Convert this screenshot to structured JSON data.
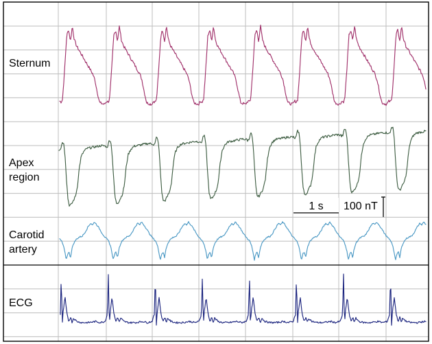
{
  "chart_data": {
    "type": "line",
    "title": "",
    "xlabel": "",
    "ylabel": "",
    "grid": true,
    "legend": "none",
    "beats_visible": 8,
    "series": [
      {
        "name": "Sternum",
        "label_lines": [
          "Sternum"
        ],
        "color": "#a0306a",
        "waveform": "sternum",
        "amplitude": 118,
        "beat_shape": [
          [
            0,
            0.04
          ],
          [
            0.03,
            0.03
          ],
          [
            0.06,
            0.06
          ],
          [
            0.1,
            0.38
          ],
          [
            0.15,
            0.85
          ],
          [
            0.19,
            0.92
          ],
          [
            0.23,
            0.78
          ],
          [
            0.27,
            0.97
          ],
          [
            0.31,
            0.8
          ],
          [
            0.36,
            0.72
          ],
          [
            0.46,
            0.62
          ],
          [
            0.56,
            0.52
          ],
          [
            0.64,
            0.44
          ],
          [
            0.7,
            0.38
          ],
          [
            0.75,
            0.3
          ],
          [
            0.8,
            0.15
          ],
          [
            0.85,
            0.02
          ],
          [
            0.9,
            0.01
          ],
          [
            0.95,
            0.0
          ],
          [
            1,
            0.04
          ]
        ]
      },
      {
        "name": "Apex region",
        "label_lines": [
          "Apex",
          "region"
        ],
        "color": "#3f5e43",
        "waveform": "apex",
        "amplitude": 100,
        "beat_shape": [
          [
            0,
            0.84
          ],
          [
            0.04,
            0.86
          ],
          [
            0.07,
            0.95
          ],
          [
            0.1,
            0.93
          ],
          [
            0.13,
            0.75
          ],
          [
            0.16,
            0.4
          ],
          [
            0.19,
            0.12
          ],
          [
            0.22,
            0.02
          ],
          [
            0.26,
            0.03
          ],
          [
            0.3,
            0.08
          ],
          [
            0.35,
            0.15
          ],
          [
            0.39,
            0.28
          ],
          [
            0.43,
            0.55
          ],
          [
            0.47,
            0.72
          ],
          [
            0.53,
            0.8
          ],
          [
            0.6,
            0.84
          ],
          [
            0.7,
            0.85
          ],
          [
            0.8,
            0.86
          ],
          [
            0.9,
            0.87
          ],
          [
            1,
            0.86
          ]
        ]
      },
      {
        "name": "Carotid artery",
        "label_lines": [
          "Carotid",
          "artery"
        ],
        "color": "#4a98c4",
        "waveform": "carotid",
        "amplitude": 58,
        "beat_shape": [
          [
            0,
            0.55
          ],
          [
            0.04,
            0.5
          ],
          [
            0.08,
            0.38
          ],
          [
            0.11,
            0.22
          ],
          [
            0.14,
            0.03
          ],
          [
            0.17,
            0.18
          ],
          [
            0.2,
            0.22
          ],
          [
            0.23,
            0.08
          ],
          [
            0.26,
            0.3
          ],
          [
            0.3,
            0.45
          ],
          [
            0.36,
            0.55
          ],
          [
            0.42,
            0.6
          ],
          [
            0.48,
            0.62
          ],
          [
            0.54,
            0.72
          ],
          [
            0.6,
            0.85
          ],
          [
            0.66,
            0.95
          ],
          [
            0.7,
            0.9
          ],
          [
            0.74,
            0.98
          ],
          [
            0.78,
            0.92
          ],
          [
            0.84,
            0.82
          ],
          [
            0.9,
            0.7
          ],
          [
            0.96,
            0.6
          ],
          [
            1,
            0.55
          ]
        ]
      },
      {
        "name": "ECG",
        "label_lines": [
          "ECG"
        ],
        "color": "#1a237e",
        "waveform": "ecg",
        "amplitude": 82,
        "beat_shape": [
          [
            0,
            0.25
          ],
          [
            0.02,
            0.98
          ],
          [
            0.04,
            0.05
          ],
          [
            0.06,
            0.3
          ],
          [
            0.1,
            0.55
          ],
          [
            0.14,
            0.25
          ],
          [
            0.18,
            0.12
          ],
          [
            0.22,
            0.2
          ],
          [
            0.25,
            0.1
          ],
          [
            0.28,
            0.18
          ],
          [
            0.35,
            0.12
          ],
          [
            0.45,
            0.1
          ],
          [
            0.6,
            0.1
          ],
          [
            0.75,
            0.12
          ],
          [
            0.85,
            0.1
          ],
          [
            0.95,
            0.12
          ],
          [
            1,
            0.25
          ]
        ]
      }
    ],
    "annotations": {
      "time_scale": {
        "label": "1 s",
        "value": 1,
        "unit": "s"
      },
      "field_scale": {
        "label": "100 nT",
        "value": 100,
        "unit": "nT"
      }
    }
  }
}
